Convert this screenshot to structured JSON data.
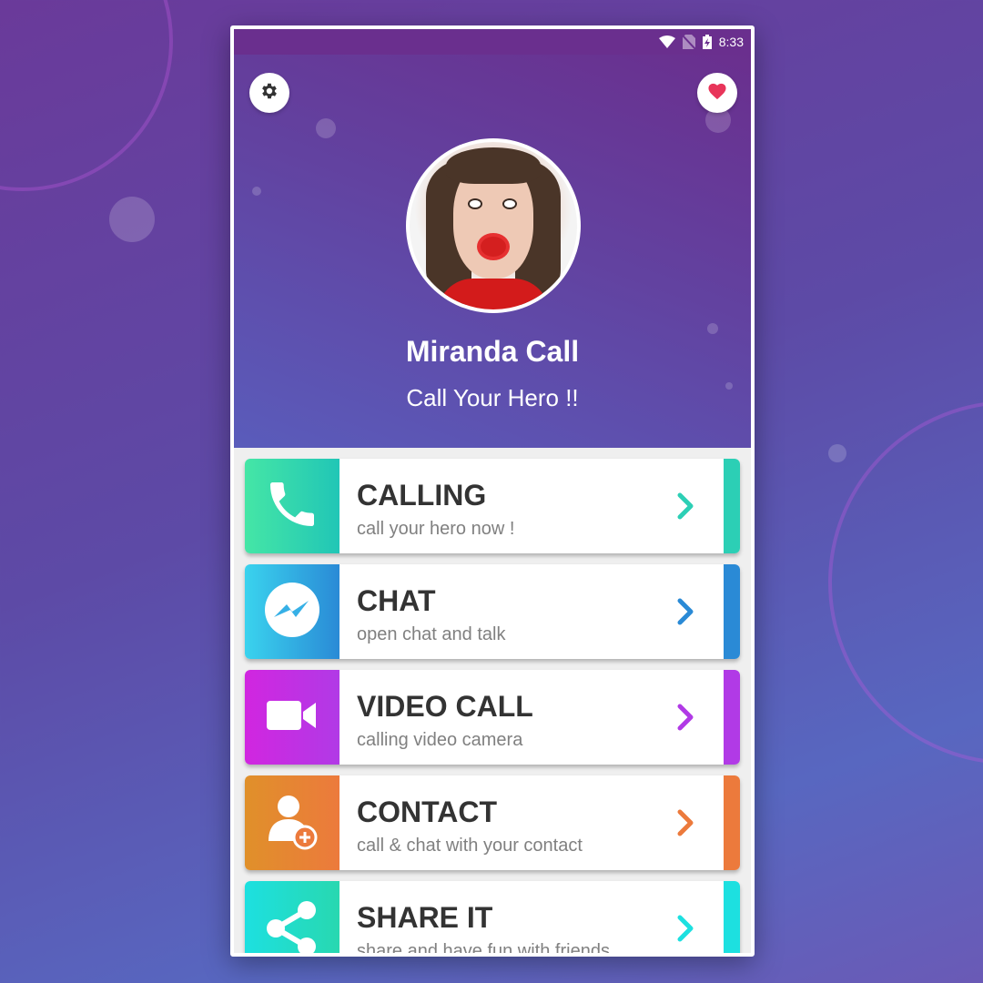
{
  "status_bar": {
    "time": "8:33"
  },
  "header": {
    "settings_icon": "gear-icon",
    "favorite_icon": "heart-icon",
    "title": "Miranda Call",
    "subtitle": "Call Your Hero !!"
  },
  "colors": {
    "heart": "#e8355a",
    "calling": "#2ccfb5",
    "chat": "#2a8ad6",
    "video": "#b13ae6",
    "contact": "#ec7a3c",
    "share": "#1de0e0"
  },
  "menu": [
    {
      "title": "CALLING",
      "subtitle": "call your hero now !",
      "icon": "phone-icon"
    },
    {
      "title": "CHAT",
      "subtitle": "open chat and talk",
      "icon": "messenger-icon"
    },
    {
      "title": "VIDEO CALL",
      "subtitle": "calling video camera",
      "icon": "video-camera-icon"
    },
    {
      "title": "CONTACT",
      "subtitle": "call & chat with your contact",
      "icon": "add-contact-icon"
    },
    {
      "title": "SHARE IT",
      "subtitle": "share and have fun with friends",
      "icon": "share-icon"
    }
  ]
}
